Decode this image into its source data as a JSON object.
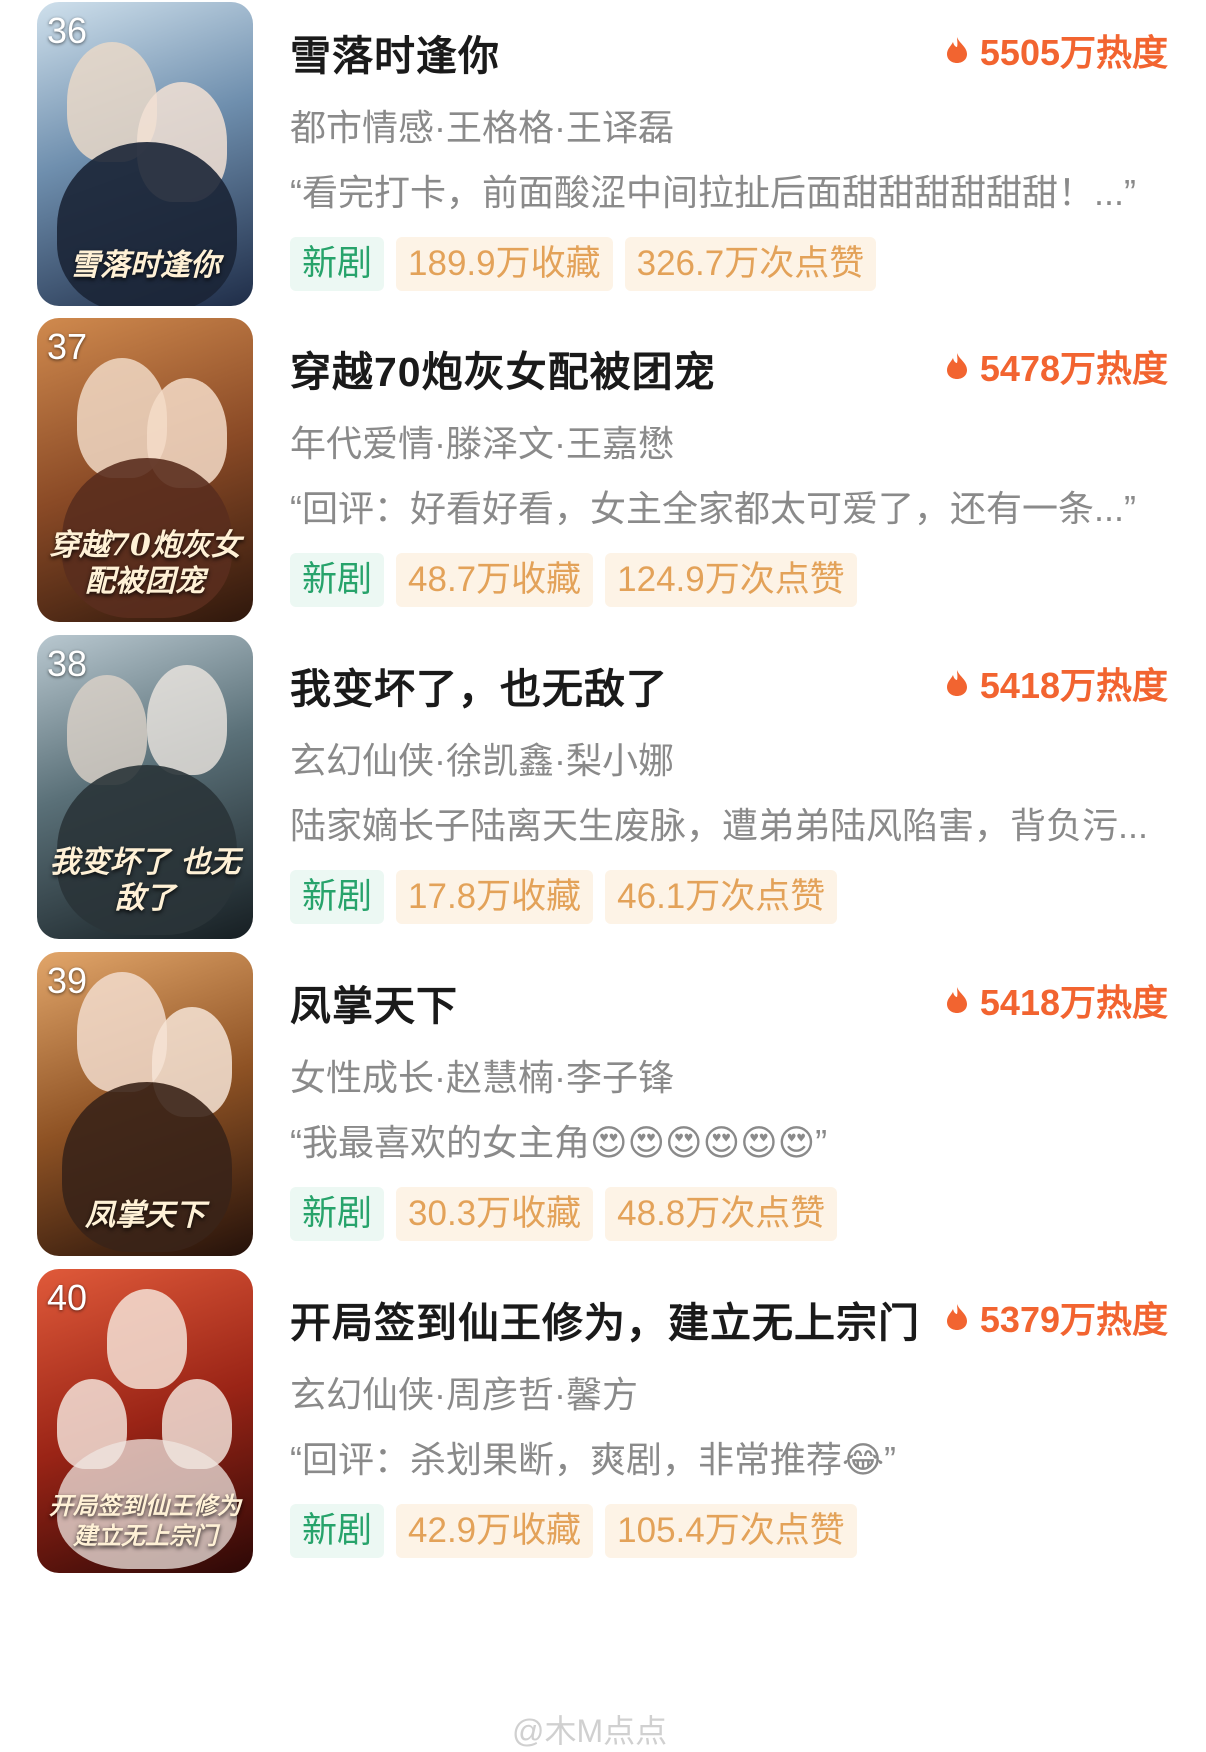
{
  "items": [
    {
      "rank": "36",
      "title": "雪落时逢你",
      "heat": "5505万热度",
      "meta": "都市情感·王格格·王译磊",
      "quote": "“看完打卡，前面酸涩中间拉扯后面甜甜甜甜甜甜！...”",
      "tag_new": "新剧",
      "favorites": "189.9万收藏",
      "likes": "326.7万次点赞",
      "poster_text": "雪落时逢你",
      "poster_colors": [
        "#a9c3d8",
        "#2a3a55"
      ]
    },
    {
      "rank": "37",
      "title": "穿越70炮灰女配被团宠",
      "heat": "5478万热度",
      "meta": "年代爱情·滕泽文·王嘉懋",
      "quote": "“回评：好看好看，女主全家都太可爱了，还有一条...”",
      "tag_new": "新剧",
      "favorites": "48.7万收藏",
      "likes": "124.9万次点赞",
      "poster_text": "穿越70炮灰女配被团宠",
      "poster_colors": [
        "#b06a3a",
        "#3a2014"
      ]
    },
    {
      "rank": "38",
      "title": "我变坏了，也无敌了",
      "heat": "5418万热度",
      "meta": "玄幻仙侠·徐凯鑫·梨小娜",
      "quote": "陆家嫡长子陆离天生废脉，遭弟弟陆风陷害，背负污...",
      "tag_new": "新剧",
      "favorites": "17.8万收藏",
      "likes": "46.1万次点赞",
      "poster_text": "我变坏了 也无敌了",
      "poster_colors": [
        "#8ea4b0",
        "#1e2a30"
      ]
    },
    {
      "rank": "39",
      "title": "凤掌天下",
      "heat": "5418万热度",
      "meta": "女性成长·赵慧楠·李子锋",
      "quote": "“我最喜欢的女主角😍😍😍😍😍😍”",
      "tag_new": "新剧",
      "favorites": "30.3万收藏",
      "likes": "48.8万次点赞",
      "poster_text": "凤掌天下",
      "poster_colors": [
        "#c98a4a",
        "#2a1408"
      ]
    },
    {
      "rank": "40",
      "title": "开局签到仙王修为，建立无上宗门",
      "heat": "5379万热度",
      "meta": "玄幻仙侠·周彦哲·馨方",
      "quote": "“回评：杀划果断，爽剧，非常推荐😂”",
      "tag_new": "新剧",
      "favorites": "42.9万收藏",
      "likes": "105.4万次点赞",
      "poster_text": "开局签到仙王修为 建立无上宗门",
      "poster_colors": [
        "#c8372a",
        "#3a0c0a"
      ]
    }
  ],
  "watermark": "@木M点点",
  "colors": {
    "heat": "#f26430",
    "new_tag_text": "#27a36b",
    "new_tag_bg": "#ecf8f3",
    "stat_tag_text": "#e3a259",
    "stat_tag_bg": "#fdf3e6"
  }
}
